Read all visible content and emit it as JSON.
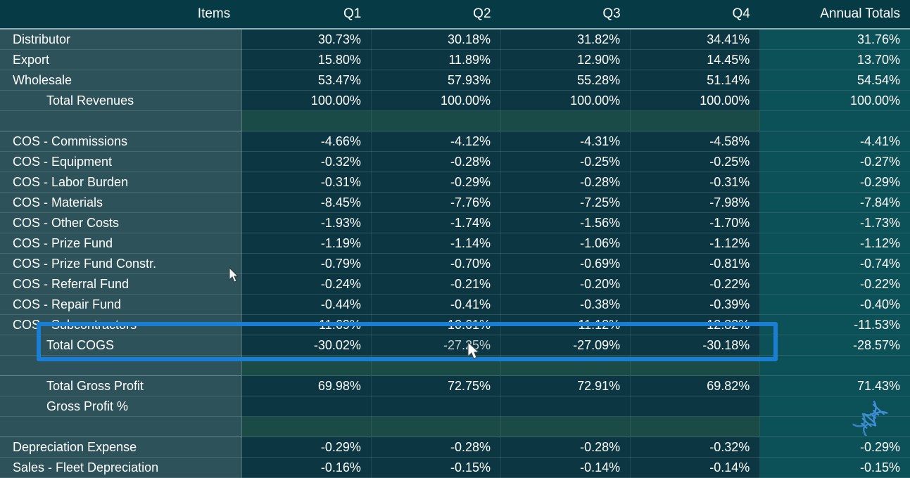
{
  "columns": {
    "items_header": "Items",
    "q1": "Q1",
    "q2": "Q2",
    "q3": "Q3",
    "q4": "Q4",
    "annual": "Annual Totals"
  },
  "colors": {
    "header_bg": "#063a44",
    "items_bg": "#2e5259",
    "cell_bg": "#0c3742",
    "total_col_bg": "#0d5158",
    "spacer_bg": "#1a4b46",
    "highlight_border": "#1a7fd4",
    "text": "#ffffff"
  },
  "rows": [
    {
      "label": "Distributor",
      "indent": 0,
      "values": [
        "30.73%",
        "30.18%",
        "31.82%",
        "34.41%"
      ],
      "total": "31.76%",
      "kind": "data"
    },
    {
      "label": "Export",
      "indent": 0,
      "values": [
        "15.80%",
        "11.89%",
        "12.90%",
        "14.45%"
      ],
      "total": "13.70%",
      "kind": "data"
    },
    {
      "label": "Wholesale",
      "indent": 0,
      "values": [
        "53.47%",
        "57.93%",
        "55.28%",
        "51.14%"
      ],
      "total": "54.54%",
      "kind": "data"
    },
    {
      "label": "Total Revenues",
      "indent": 1,
      "values": [
        "100.00%",
        "100.00%",
        "100.00%",
        "100.00%"
      ],
      "total": "100.00%",
      "kind": "subtotal"
    },
    {
      "label": "",
      "indent": 0,
      "values": [
        "",
        "",
        "",
        ""
      ],
      "total": "",
      "kind": "spacer"
    },
    {
      "label": "COS - Commissions",
      "indent": 0,
      "values": [
        "-4.66%",
        "-4.12%",
        "-4.31%",
        "-4.58%"
      ],
      "total": "-4.41%",
      "kind": "data"
    },
    {
      "label": "COS - Equipment",
      "indent": 0,
      "values": [
        "-0.32%",
        "-0.28%",
        "-0.25%",
        "-0.25%"
      ],
      "total": "-0.27%",
      "kind": "data"
    },
    {
      "label": "COS - Labor Burden",
      "indent": 0,
      "values": [
        "-0.31%",
        "-0.29%",
        "-0.28%",
        "-0.31%"
      ],
      "total": "-0.29%",
      "kind": "data"
    },
    {
      "label": "COS - Materials",
      "indent": 0,
      "values": [
        "-8.45%",
        "-7.76%",
        "-7.25%",
        "-7.98%"
      ],
      "total": "-7.84%",
      "kind": "data"
    },
    {
      "label": "COS - Other Costs",
      "indent": 0,
      "values": [
        "-1.93%",
        "-1.74%",
        "-1.56%",
        "-1.70%"
      ],
      "total": "-1.73%",
      "kind": "data"
    },
    {
      "label": "COS - Prize Fund",
      "indent": 0,
      "values": [
        "-1.19%",
        "-1.14%",
        "-1.06%",
        "-1.12%"
      ],
      "total": "-1.12%",
      "kind": "data"
    },
    {
      "label": "COS - Prize Fund Constr.",
      "indent": 0,
      "values": [
        "-0.79%",
        "-0.70%",
        "-0.69%",
        "-0.81%"
      ],
      "total": "-0.74%",
      "kind": "data"
    },
    {
      "label": "COS - Referral Fund",
      "indent": 0,
      "values": [
        "-0.24%",
        "-0.21%",
        "-0.20%",
        "-0.22%"
      ],
      "total": "-0.22%",
      "kind": "data"
    },
    {
      "label": "COS - Repair Fund",
      "indent": 0,
      "values": [
        "-0.44%",
        "-0.41%",
        "-0.38%",
        "-0.39%"
      ],
      "total": "-0.40%",
      "kind": "data"
    },
    {
      "label": "COS - Subcontractors",
      "indent": 0,
      "values": [
        "-11.69%",
        "-10.61%",
        "-11.12%",
        "-12.82%"
      ],
      "total": "-11.53%",
      "kind": "data"
    },
    {
      "label": "Total COGS",
      "indent": 1,
      "values": [
        "-30.02%",
        "-27.25%",
        "-27.09%",
        "-30.18%"
      ],
      "total": "-28.57%",
      "kind": "subtotal"
    },
    {
      "label": "",
      "indent": 0,
      "values": [
        "",
        "",
        "",
        ""
      ],
      "total": "",
      "kind": "spacer"
    },
    {
      "label": "Total Gross Profit",
      "indent": 1,
      "values": [
        "69.98%",
        "72.75%",
        "72.91%",
        "69.82%"
      ],
      "total": "71.43%",
      "kind": "subtotal"
    },
    {
      "label": "Gross Profit %",
      "indent": 1,
      "values": [
        "",
        "",
        "",
        ""
      ],
      "total": "",
      "kind": "subtotal-blank"
    },
    {
      "label": "",
      "indent": 0,
      "values": [
        "",
        "",
        "",
        ""
      ],
      "total": "",
      "kind": "spacer"
    },
    {
      "label": "Depreciation Expense",
      "indent": 0,
      "values": [
        "-0.29%",
        "-0.28%",
        "-0.28%",
        "-0.32%"
      ],
      "total": "-0.29%",
      "kind": "data"
    },
    {
      "label": "Sales - Fleet Depreciation",
      "indent": 0,
      "values": [
        "-0.16%",
        "-0.15%",
        "-0.14%",
        "-0.14%"
      ],
      "total": "-0.15%",
      "kind": "data"
    }
  ],
  "overlay": {
    "highlight_row_label": "Total COGS",
    "dna_icon": "dna-helix-icon",
    "cursor_icon": "mouse-pointer-icon"
  }
}
